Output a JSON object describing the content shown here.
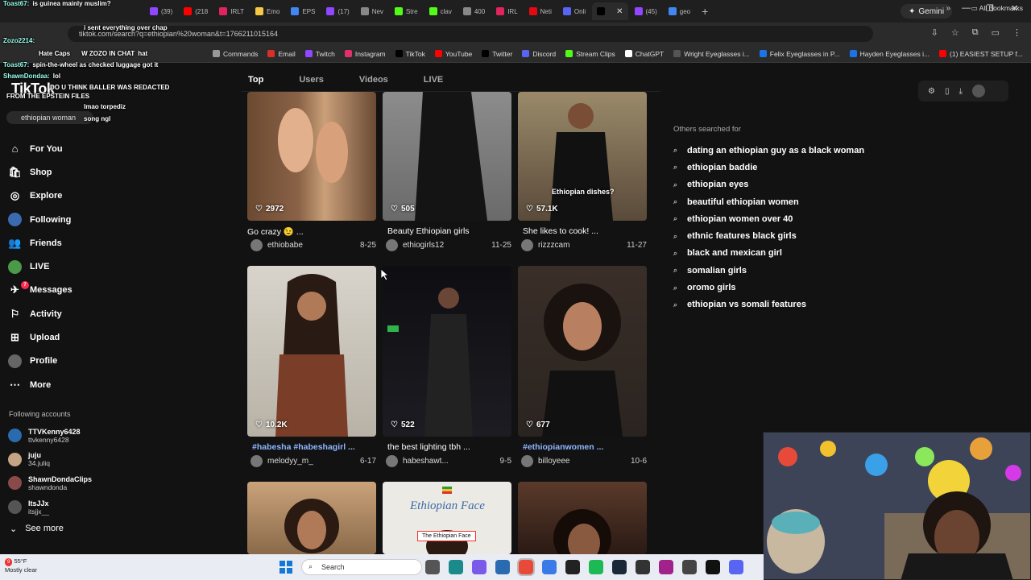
{
  "browser": {
    "tabs": [
      {
        "label": "(39)",
        "color": "#9146ff"
      },
      {
        "label": "(218",
        "color": "#ff0000"
      },
      {
        "label": "IRLT",
        "color": "#e0245e"
      },
      {
        "label": "Emo",
        "color": "#f7c843"
      },
      {
        "label": "EPS",
        "color": "#4285f4"
      },
      {
        "label": "(17)",
        "color": "#9146ff"
      },
      {
        "label": "Nev",
        "color": "#888888"
      },
      {
        "label": "Stre",
        "color": "#53fc18"
      },
      {
        "label": "clav",
        "color": "#53fc18"
      },
      {
        "label": "400",
        "color": "#888888"
      },
      {
        "label": "IRL",
        "color": "#e0245e"
      },
      {
        "label": "Neti",
        "color": "#e50914"
      },
      {
        "label": "Onli",
        "color": "#5865f2"
      },
      {
        "label": "",
        "color": "#000000",
        "active": true
      },
      {
        "label": "(45)",
        "color": "#9146ff"
      },
      {
        "label": "geo",
        "color": "#4285f4"
      }
    ],
    "gemini_label": "Gemini",
    "url": "tiktok.com/search?q=ethiopian%20woman&t=1766211015164",
    "bookmarks": [
      {
        "label": "Email",
        "color": "#d93025"
      },
      {
        "label": "Twitch",
        "color": "#9146ff"
      },
      {
        "label": "Instagram",
        "color": "#e1306c"
      },
      {
        "label": "TikTok",
        "color": "#000000"
      },
      {
        "label": "YouTube",
        "color": "#ff0000"
      },
      {
        "label": "Twitter",
        "color": "#000000"
      },
      {
        "label": "Discord",
        "color": "#5865f2"
      },
      {
        "label": "Stream Clips",
        "color": "#53fc18"
      },
      {
        "label": "ChatGPT",
        "color": "#ffffff"
      },
      {
        "label": "Wright Eyeglasses i...",
        "color": "#555555"
      },
      {
        "label": "Felix Eyeglasses in P...",
        "color": "#1a73e8"
      },
      {
        "label": "Hayden Eyeglasses i...",
        "color": "#1a73e8"
      },
      {
        "label": "(1) EASIEST SETUP f...",
        "color": "#ff0000"
      }
    ],
    "bookmarks_more": "»",
    "all_bookmarks": "All Bookmarks",
    "partial_bookmarks": [
      "Commands"
    ]
  },
  "chat": [
    {
      "user": "Toast67:",
      "msg": "is guinea mainly muslim?"
    },
    {
      "user": "",
      "msg": "i sent everything over chap"
    },
    {
      "user": "Zozo2214:",
      "msg": ""
    },
    {
      "user": "Toast67:",
      "msg": "spin-the-wheel as checked luggage got it"
    },
    {
      "user": "ShawnDondaa:",
      "msg": "lol"
    },
    {
      "user": "",
      "msg": "DO U THINK BALLER WAS REDACTED"
    },
    {
      "user": "",
      "msg": "FROM THE EPSTEIN FILES"
    },
    {
      "user": "",
      "msg": "lmao torpediz"
    },
    {
      "user": "",
      "msg": "song ngl"
    }
  ],
  "chat_extra": {
    "hate_caps": "Hate Caps",
    "zozo_chat": "W ZOZO IN CHAT",
    "hat": "hat"
  },
  "tiktok": {
    "logo": "TikTok",
    "search_value": "ethiopian woman",
    "nav": [
      {
        "label": "For You",
        "icon": "home-icon",
        "glyph": "⌂"
      },
      {
        "label": "Shop",
        "icon": "shop-icon",
        "glyph": "🛍"
      },
      {
        "label": "Explore",
        "icon": "compass-icon",
        "glyph": "◎"
      },
      {
        "label": "Following",
        "icon": "following-avatar-icon",
        "glyph": ""
      },
      {
        "label": "Friends",
        "icon": "friends-icon",
        "glyph": "👥"
      },
      {
        "label": "LIVE",
        "icon": "live-avatar-icon",
        "glyph": ""
      },
      {
        "label": "Messages",
        "icon": "messages-icon",
        "glyph": "✈",
        "badge": "7"
      },
      {
        "label": "Activity",
        "icon": "activity-icon",
        "glyph": "⚐"
      },
      {
        "label": "Upload",
        "icon": "upload-icon",
        "glyph": "⊞"
      },
      {
        "label": "Profile",
        "icon": "profile-avatar-icon",
        "glyph": ""
      },
      {
        "label": "More",
        "icon": "more-icon",
        "glyph": "⋯"
      }
    ],
    "following_heading": "Following accounts",
    "following": [
      {
        "name": "TTVKenny6428",
        "handle": "ttvkenny6428",
        "color": "#2a6bb0"
      },
      {
        "name": "juju",
        "handle": "34.juliq",
        "color": "#c4a484"
      },
      {
        "name": "ShawnDondaClips",
        "handle": "shawndonda",
        "color": "#8a4a4a"
      },
      {
        "name": "ItsJJx",
        "handle": "itsjjx__",
        "color": "#555555"
      }
    ],
    "see_more": "See more",
    "search_tabs": [
      "Top",
      "Users",
      "Videos",
      "LIVE"
    ],
    "videos": [
      {
        "likes": "2972",
        "caption": "Go crazy 😉 ...",
        "user": "ethiobabe",
        "date": "8-25"
      },
      {
        "likes": "505",
        "caption": "Beauty Ethiopian girls",
        "user": "ethiogirls12",
        "date": "11-25"
      },
      {
        "likes": "57.1K",
        "caption": "She likes to cook! ...",
        "user": "rizzzcam",
        "date": "11-27",
        "overlay": "Ethiopian dishes?"
      },
      {
        "likes": "10.2K",
        "caption": "#habesha #habeshagirl ...",
        "user": "melodyy_m_",
        "date": "6-17",
        "tag": true
      },
      {
        "likes": "522",
        "caption": "the best lighting tbh ...",
        "user": "habeshawt...",
        "date": "9-5"
      },
      {
        "likes": "677",
        "caption": "#ethiopianwomen ...",
        "user": "billoyeee",
        "date": "10-6",
        "tag": true
      },
      {
        "likes": "",
        "caption": "",
        "user": "",
        "date": ""
      },
      {
        "likes": "",
        "caption": "",
        "user": "",
        "date": "",
        "overlay_title": "Ethiopian Face",
        "overlay_sub": "The Ethiopian Face"
      },
      {
        "likes": "",
        "caption": "",
        "user": "",
        "date": ""
      }
    ],
    "others_heading": "Others searched for",
    "suggestions": [
      "dating an ethiopian guy as a black woman",
      "ethiopian baddie",
      "ethiopian eyes",
      "beautiful ethiopian women",
      "ethiopian women over 40",
      "ethnic features black girls",
      "black and mexican girl",
      "somalian girls",
      "oromo girls",
      "ethiopian vs somali features"
    ]
  },
  "taskbar": {
    "weather_temp": "55°F",
    "weather_desc": "Mostly clear",
    "weather_badge": "9",
    "search_placeholder": "Search"
  },
  "colors": {
    "accent": "#fe2c55",
    "link": "#8fb6ff",
    "background": "#121212"
  }
}
